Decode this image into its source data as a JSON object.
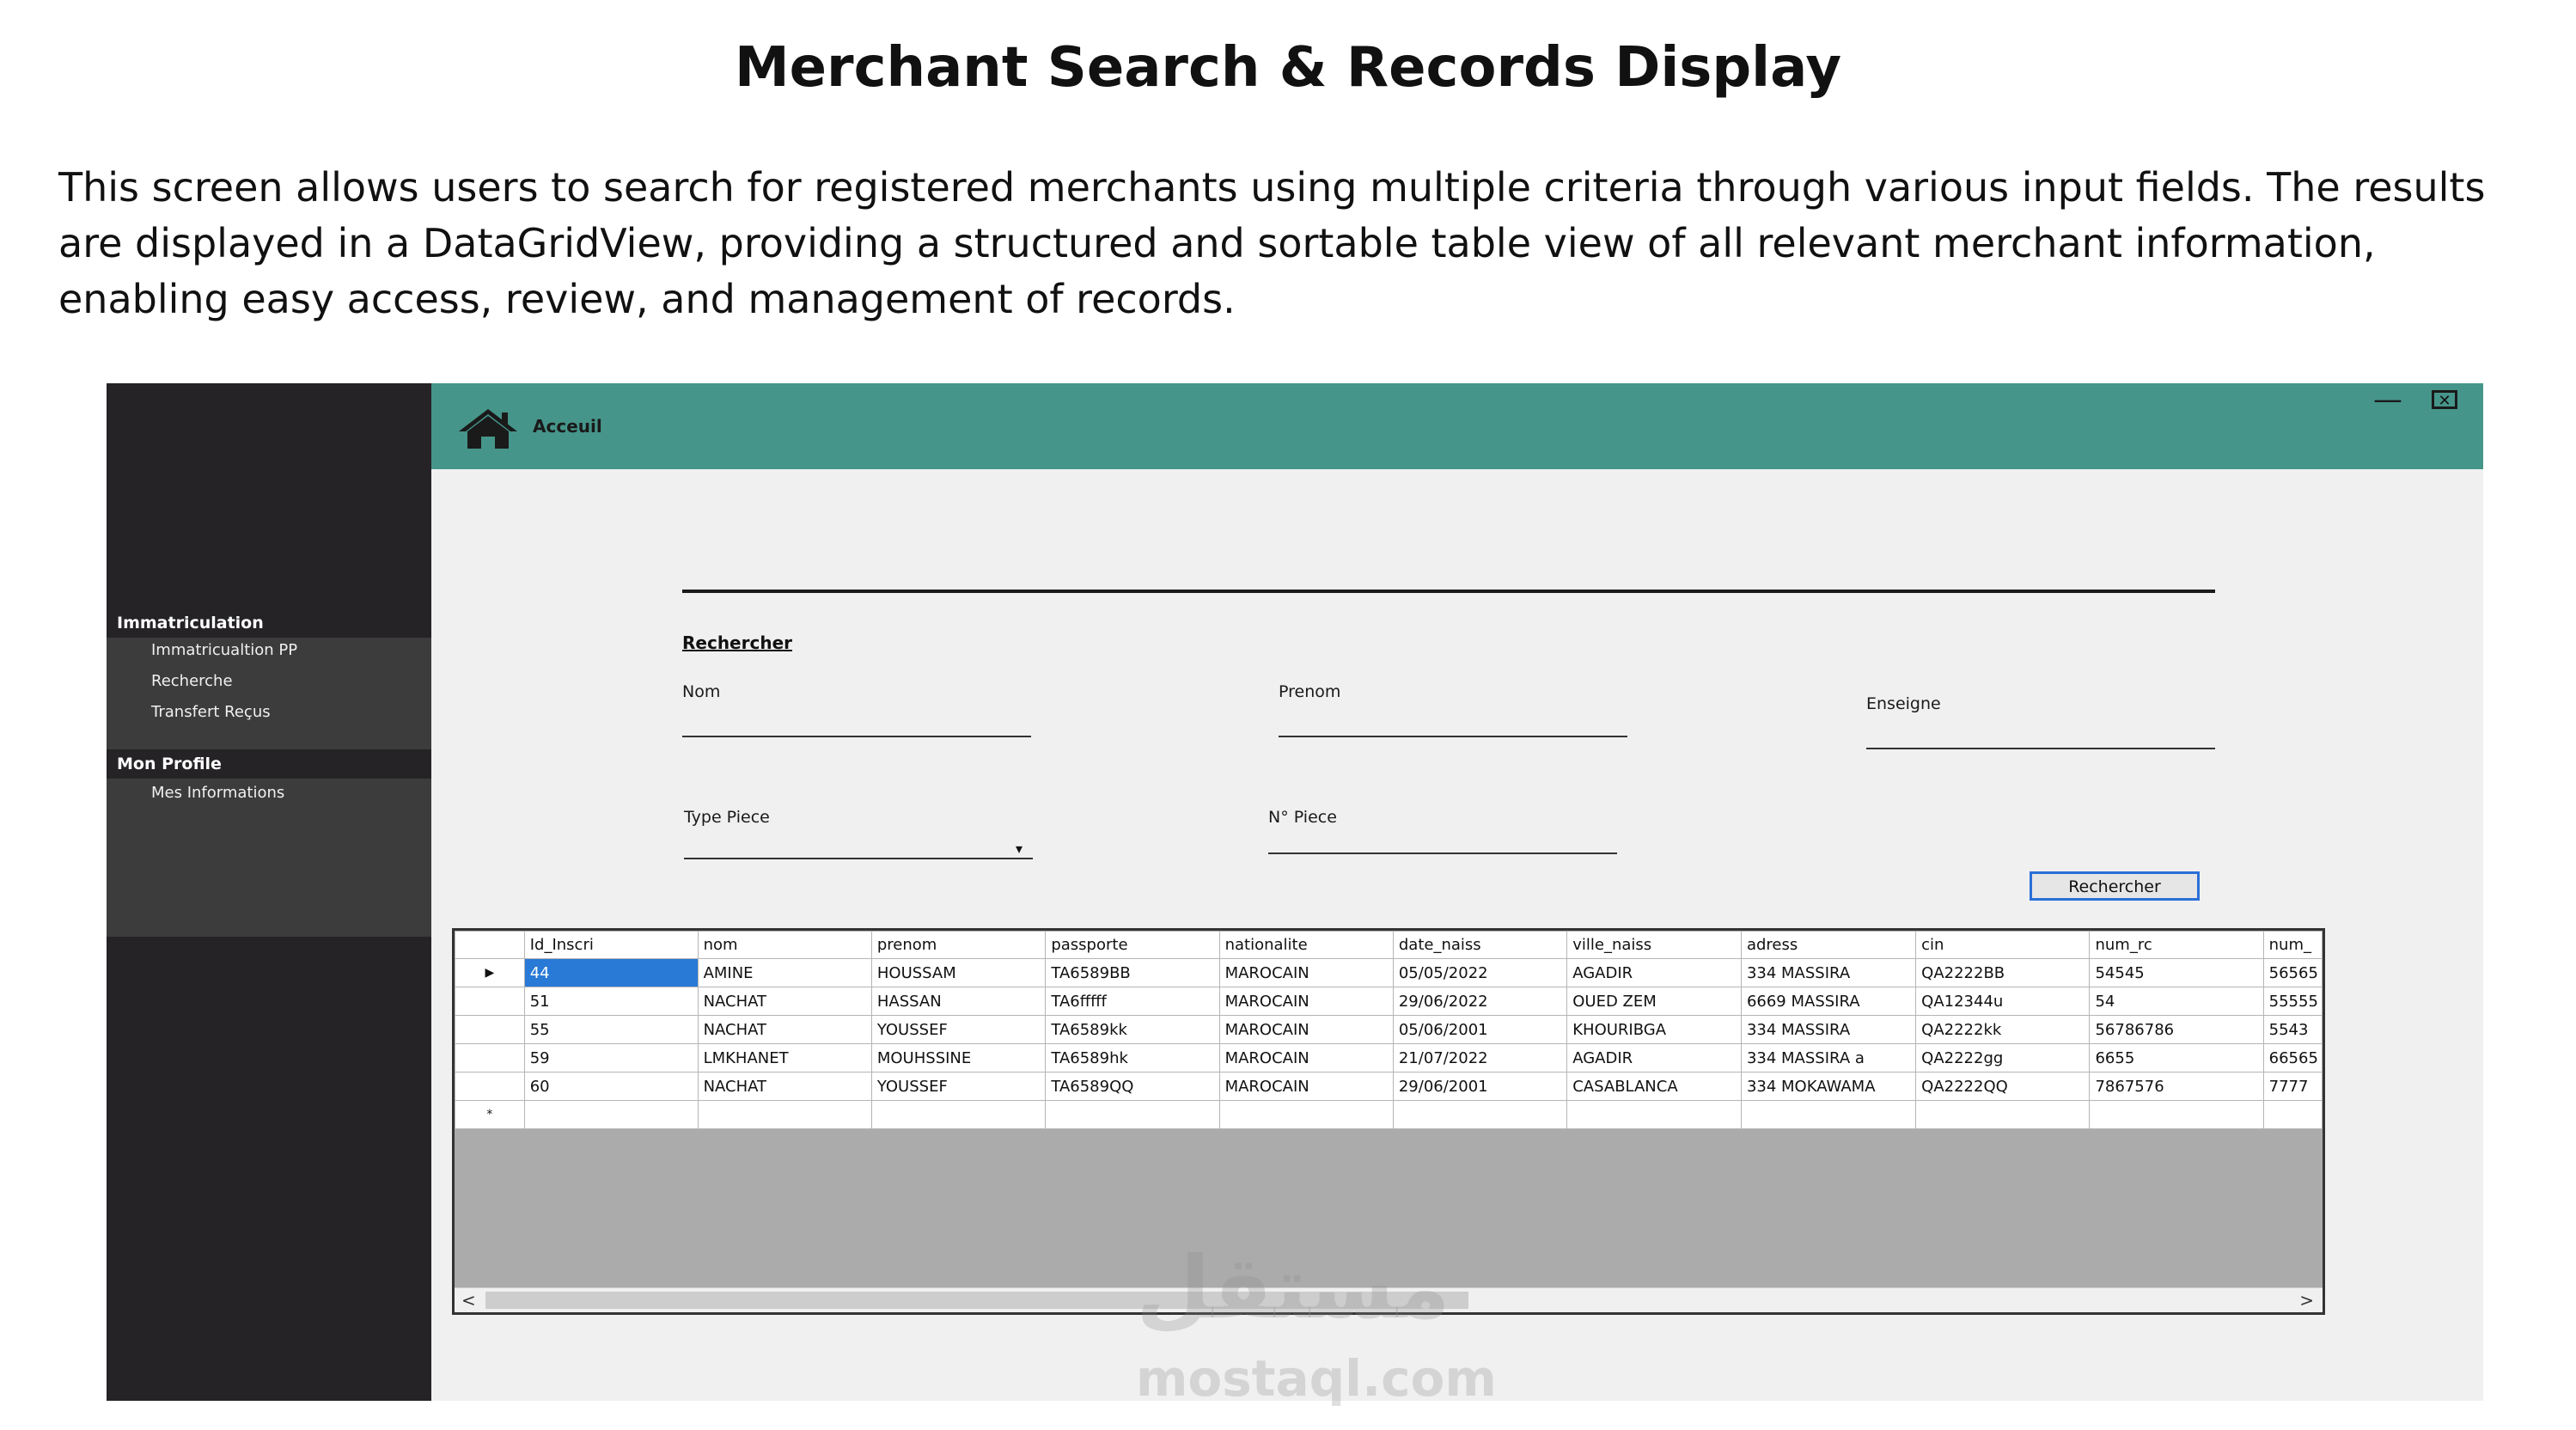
{
  "page": {
    "title": "Merchant Search & Records Display",
    "description": "This screen allows users to search for registered merchants using multiple criteria through various input fields. The results are displayed in a DataGridView, providing a structured and sortable table view of all relevant merchant information, enabling easy access, review, and management of records."
  },
  "colors": {
    "header": "#46958a",
    "sidebar": "#252326",
    "sidebar_panel": "#3c3c3c",
    "selection": "#2979d6"
  },
  "app": {
    "header": {
      "icon": "home-icon",
      "label": "Acceuil",
      "minimize": "—",
      "close": "✕"
    },
    "sidebar": {
      "sections": [
        {
          "title": "Immatriculation",
          "items": [
            "Immatricualtion PP",
            "Recherche",
            "Transfert Reçus"
          ]
        },
        {
          "title": "Mon Profile",
          "items": [
            "Mes Informations"
          ]
        }
      ]
    },
    "search": {
      "section_title": "Rechercher",
      "nom_label": "Nom",
      "prenom_label": "Prenom",
      "enseigne_label": "Enseigne",
      "type_piece_label": "Type Piece",
      "n_piece_label": "N° Piece",
      "button_label": "Rechercher"
    },
    "grid": {
      "columns": [
        "Id_Inscri",
        "nom",
        "prenom",
        "passporte",
        "nationalite",
        "date_naiss",
        "ville_naiss",
        "adress",
        "cin",
        "num_rc",
        "num_"
      ],
      "rows": [
        [
          "44",
          "AMINE",
          "HOUSSAM",
          "TA6589BB",
          "MAROCAIN",
          "05/05/2022",
          "AGADIR",
          "334 MASSIRA",
          "QA2222BB",
          "54545",
          "56565"
        ],
        [
          "51",
          "NACHAT",
          "HASSAN",
          "TA6fffff",
          "MAROCAIN",
          "29/06/2022",
          "OUED ZEM",
          "6669 MASSIRA",
          "QA12344u",
          "54",
          "55555"
        ],
        [
          "55",
          "NACHAT",
          "YOUSSEF",
          "TA6589kk",
          "MAROCAIN",
          "05/06/2001",
          "KHOURIBGA",
          "334 MASSIRA",
          "QA2222kk",
          "56786786",
          "5543"
        ],
        [
          "59",
          "LMKHANET",
          "MOUHSSINE",
          "TA6589hk",
          "MAROCAIN",
          "21/07/2022",
          "AGADIR",
          "334 MASSIRA a",
          "QA2222gg",
          "6655",
          "66565"
        ],
        [
          "60",
          "NACHAT",
          "YOUSSEF",
          "TA6589QQ",
          "MAROCAIN",
          "29/06/2001",
          "CASABLANCA",
          "334 MOKAWAMA",
          "QA2222QQ",
          "7867576",
          "7777"
        ]
      ],
      "current_row_marker": "▶",
      "new_row_marker": "*",
      "scroll_left": "<",
      "scroll_right": ">"
    }
  },
  "watermark": {
    "arabic": "مستقل",
    "latin": "mostaql.com"
  }
}
